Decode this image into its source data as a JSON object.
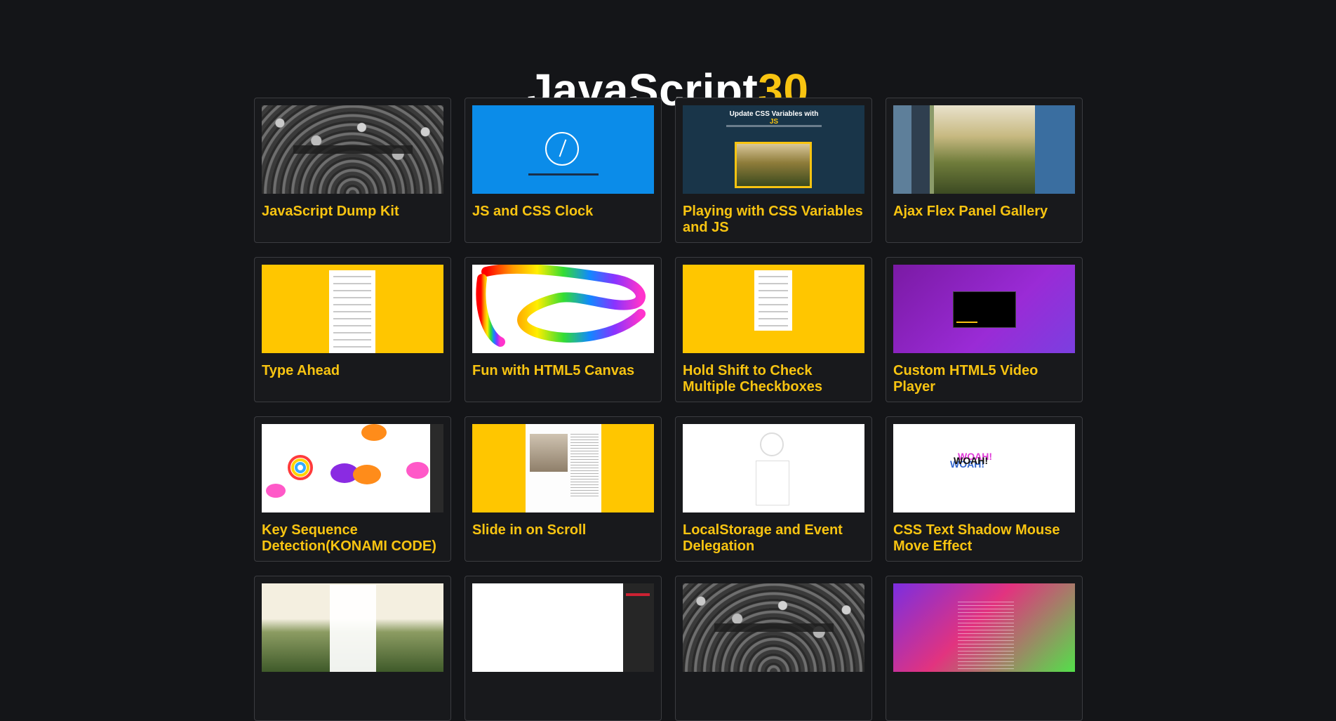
{
  "header": {
    "title_main": "JavaScript",
    "title_accent": "30"
  },
  "projects": [
    {
      "title": "JavaScript Dump Kit",
      "thumb": "crowd-with-drum-kit"
    },
    {
      "title": "JS and CSS Clock",
      "thumb": "clock-on-blue"
    },
    {
      "title": "Playing with CSS Variables and JS",
      "thumb": "css-variables-demo",
      "thumb_heading": "Update CSS Variables with",
      "thumb_heading_accent": "JS"
    },
    {
      "title": "Ajax Flex Panel Gallery",
      "thumb": "flex-panels"
    },
    {
      "title": "Type Ahead",
      "thumb": "type-ahead-list"
    },
    {
      "title": "Fun with HTML5 Canvas",
      "thumb": "rainbow-canvas"
    },
    {
      "title": "Hold Shift to Check Multiple Checkboxes",
      "thumb": "checkbox-list"
    },
    {
      "title": "Custom HTML5 Video Player",
      "thumb": "video-player"
    },
    {
      "title": "Key Sequence Detection(KONAMI CODE)",
      "thumb": "unicorns"
    },
    {
      "title": "Slide in on Scroll",
      "thumb": "article-page"
    },
    {
      "title": "LocalStorage and Event Delegation",
      "thumb": "local-tapas"
    },
    {
      "title": "CSS Text Shadow Mouse Move Effect",
      "thumb": "woah-text",
      "thumb_text": "WOAH!"
    },
    {
      "title": "",
      "thumb": "nature-menu"
    },
    {
      "title": "",
      "thumb": "dev-tools"
    },
    {
      "title": "",
      "thumb": "crowd-with-drum-kit"
    },
    {
      "title": "",
      "thumb": "gradient-nav"
    }
  ],
  "colors": {
    "accent": "#f8c411",
    "background": "#141518",
    "card_border": "#3b3c40"
  }
}
